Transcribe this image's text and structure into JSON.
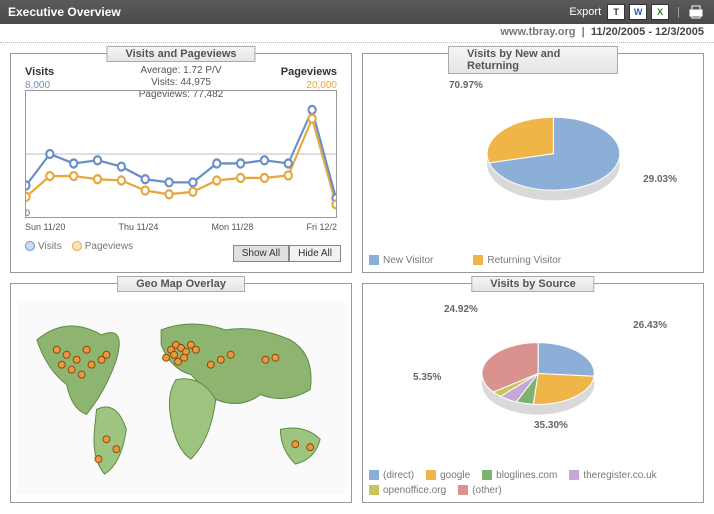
{
  "header": {
    "title": "Executive Overview",
    "export_label": "Export"
  },
  "subheader": {
    "site": "www.tbray.org",
    "date_range": "11/20/2005 - 12/3/2005"
  },
  "panels": {
    "visits_pageviews": {
      "title": "Visits and Pageviews",
      "left_axis_label": "Visits",
      "left_axis_max": "8,000",
      "right_axis_label": "Pageviews",
      "right_axis_max": "20,000",
      "zero_label": "0",
      "stats_avg": "Average: 1.72 P/V",
      "stats_visits": "Visits: 44,975",
      "stats_pv": "Pageviews: 77,482",
      "x_labels": [
        "Sun 11/20",
        "Thu 11/24",
        "Mon 11/28",
        "Fri 12/2"
      ],
      "legend_visits": "Visits",
      "legend_pv": "Pageviews",
      "btn_show_all": "Show All",
      "btn_hide_all": "Hide All"
    },
    "new_returning": {
      "title": "Visits by New and Returning",
      "label_new": "70.97%",
      "label_ret": "29.03%",
      "legend_new": "New Visitor",
      "legend_ret": "Returning Visitor"
    },
    "geomap": {
      "title": "Geo Map Overlay"
    },
    "sources": {
      "title": "Visits by Source",
      "lbl_direct": "26.43%",
      "lbl_google": "24.92%",
      "lbl_theregister": "5.35%",
      "lbl_other": "35.30%",
      "legend_direct": "(direct)",
      "legend_google": "google",
      "legend_bloglines": "bloglines.com",
      "legend_theregister": "theregister.co.uk",
      "legend_openoffice": "openoffice.org",
      "legend_other": "(other)"
    }
  },
  "chart_data": [
    {
      "type": "line",
      "title": "Visits and Pageviews",
      "x": [
        "11/20",
        "11/21",
        "11/22",
        "11/23",
        "11/24",
        "11/25",
        "11/26",
        "11/27",
        "11/28",
        "11/29",
        "11/30",
        "12/1",
        "12/2",
        "12/3"
      ],
      "series": [
        {
          "name": "Visits",
          "axis": "left",
          "color": "#6a8fc6",
          "values": [
            2000,
            4000,
            3400,
            3600,
            3200,
            2400,
            2200,
            2200,
            3400,
            3400,
            3600,
            3400,
            6800,
            1200
          ]
        },
        {
          "name": "Pageviews",
          "axis": "right",
          "color": "#e8a73d",
          "values": [
            3200,
            6500,
            6500,
            6000,
            5800,
            4200,
            3600,
            4000,
            5800,
            6200,
            6200,
            6600,
            15600,
            2000
          ]
        }
      ],
      "left_ylim": [
        0,
        8000
      ],
      "right_ylim": [
        0,
        20000
      ],
      "summary": {
        "avg_pv_per_visit": 1.72,
        "total_visits": 44975,
        "total_pageviews": 77482
      }
    },
    {
      "type": "pie",
      "title": "Visits by New and Returning",
      "categories": [
        "New Visitor",
        "Returning Visitor"
      ],
      "values": [
        70.97,
        29.03
      ],
      "colors": [
        "#8cafd7",
        "#efb548"
      ]
    },
    {
      "type": "pie",
      "title": "Visits by Source",
      "categories": [
        "(direct)",
        "google",
        "bloglines.com",
        "theregister.co.uk",
        "openoffice.org",
        "(other)"
      ],
      "values": [
        26.43,
        24.92,
        5.0,
        5.35,
        3.0,
        35.3
      ],
      "colors": [
        "#8cafd7",
        "#efb548",
        "#7eb36f",
        "#c6a7d6",
        "#c8c35c",
        "#d9928d"
      ]
    }
  ]
}
